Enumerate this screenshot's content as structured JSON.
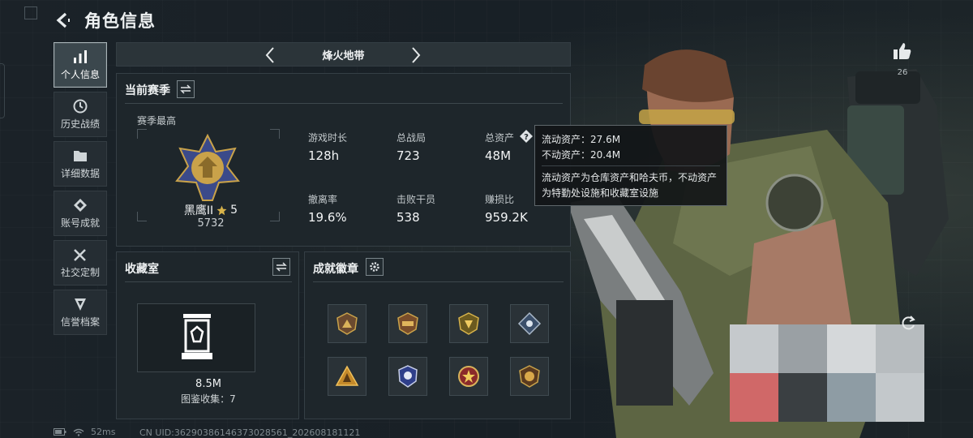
{
  "header": {
    "title": "角色信息"
  },
  "sidebar": {
    "items": [
      {
        "label": "个人信息",
        "icon": "bar-chart-icon",
        "active": true
      },
      {
        "label": "历史战绩",
        "icon": "history-icon",
        "active": false
      },
      {
        "label": "详细数据",
        "icon": "folder-icon",
        "active": false
      },
      {
        "label": "账号成就",
        "icon": "achievement-icon",
        "active": false
      },
      {
        "label": "社交定制",
        "icon": "tools-icon",
        "active": false
      },
      {
        "label": "信誉档案",
        "icon": "credit-icon",
        "active": false
      }
    ]
  },
  "map_selector": {
    "name": "烽火地带"
  },
  "season": {
    "title": "当前赛季",
    "best_label": "赛季最高",
    "rank_name": "黑鹰II",
    "rank_stars": "5",
    "rank_score": "5732",
    "stats": [
      {
        "label": "游戏时长",
        "value": "128h"
      },
      {
        "label": "总战局",
        "value": "723"
      },
      {
        "label": "总资产",
        "value": "48M"
      },
      {
        "label": "撤离率",
        "value": "19.6%"
      },
      {
        "label": "击败干员",
        "value": "538"
      },
      {
        "label": "赚损比",
        "value": "959.2K"
      }
    ]
  },
  "tooltip": {
    "liquid": "流动资产：27.6M",
    "fixed": "不动资产：20.4M",
    "desc_line1": "流动资产为仓库资产和哈夫币，不动资产",
    "desc_line2": "为特勤处设施和收藏室设施"
  },
  "collection": {
    "title": "收藏室",
    "value": "8.5M",
    "count_text": "图鉴收集：7"
  },
  "achievements": {
    "title": "成就徽章",
    "badges": [
      "badge-1",
      "badge-2",
      "badge-3",
      "badge-4",
      "badge-5",
      "badge-6",
      "badge-7",
      "badge-8"
    ]
  },
  "status_bar": {
    "ping": "52ms",
    "uid": "CN UID:3629038614637302856​1_202608181121"
  },
  "like": {
    "count": "26"
  },
  "colors": {
    "accent_gold": "#c9a24a",
    "panel_bg": "#1e262b",
    "active_border": "#a9b4b8"
  }
}
